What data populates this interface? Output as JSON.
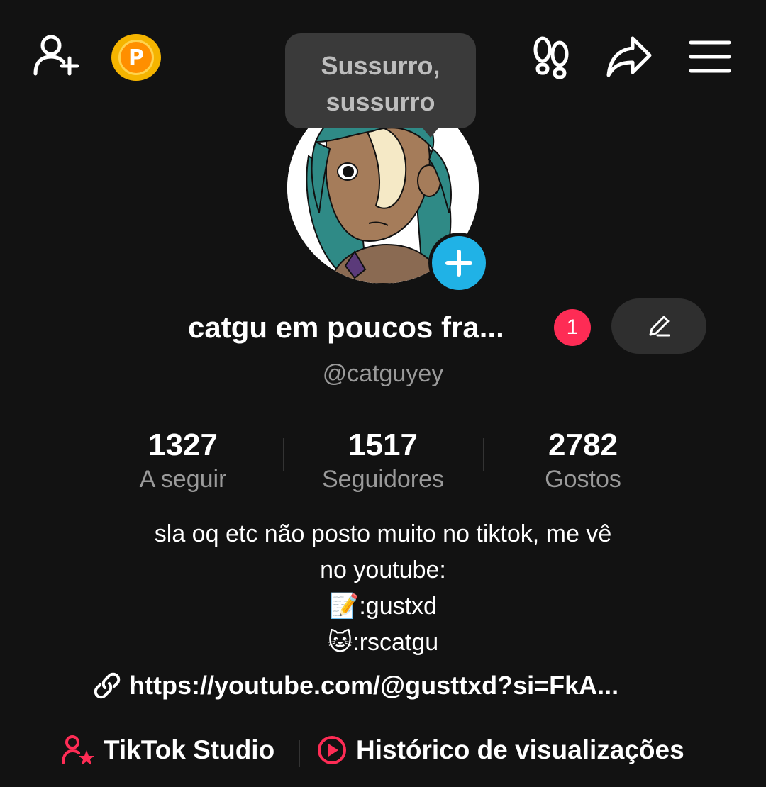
{
  "topbar": {
    "add_friend_icon": "person-plus-icon",
    "coin_label": "P",
    "footprints_icon": "footprints-icon",
    "share_icon": "share-icon",
    "menu_icon": "hamburger-menu-icon"
  },
  "tooltip": {
    "line1": "Sussurro,",
    "line2": "sussurro"
  },
  "profile": {
    "display_name": "catgu em poucos fra...",
    "notification_count": "1",
    "username": "@catguyey"
  },
  "stats": [
    {
      "value": "1327",
      "label": "A seguir"
    },
    {
      "value": "1517",
      "label": "Seguidores"
    },
    {
      "value": "2782",
      "label": "Gostos"
    }
  ],
  "bio": {
    "line1": "sla oq etc não posto muito no tiktok, me vê",
    "line2": "no youtube:",
    "line3": "📝:gustxd",
    "line4": "🐱:rscatgu"
  },
  "link": "https://youtube.com/@gusttxd?si=FkA...",
  "bottom": {
    "studio_label": "TikTok Studio",
    "history_label": "Histórico de visualizações"
  },
  "colors": {
    "background": "#121212",
    "accent_red": "#fe2c55",
    "accent_blue": "#20b2e6",
    "coin": "#ff8f00"
  }
}
